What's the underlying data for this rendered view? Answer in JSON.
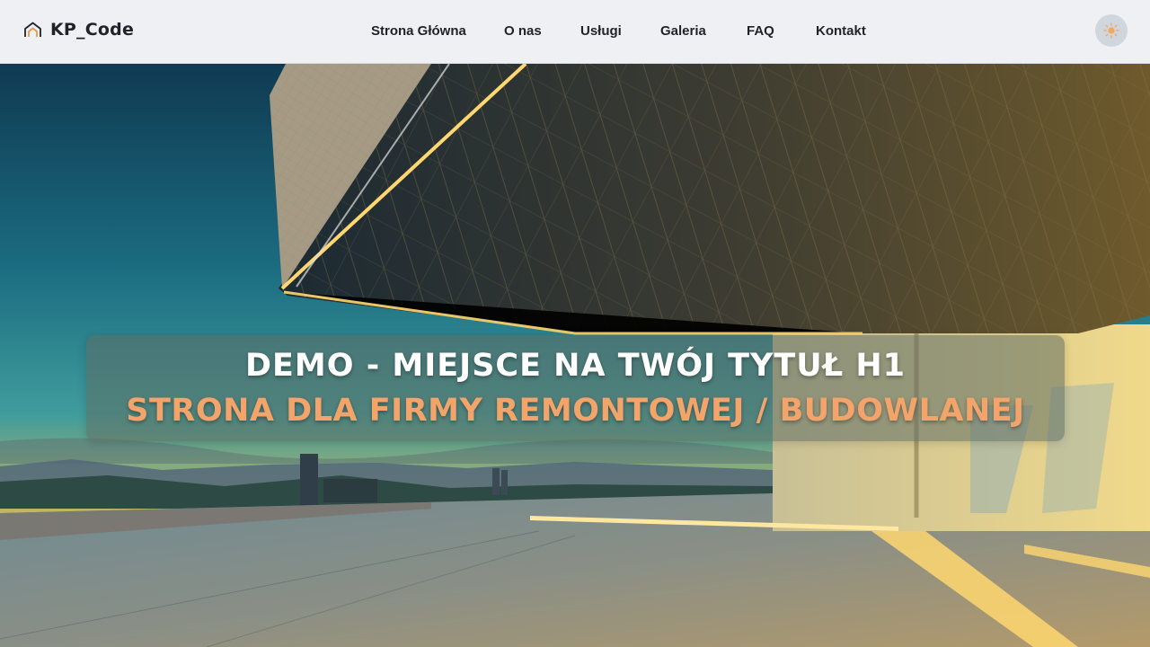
{
  "header": {
    "logo_text": "KP_Code",
    "logo_icon": "house-outline-icon",
    "nav": [
      {
        "label": "Strona Główna"
      },
      {
        "label": "O nas"
      },
      {
        "label": "Usługi"
      },
      {
        "label": "Galeria"
      },
      {
        "label": "FAQ"
      },
      {
        "label": "Kontakt"
      }
    ],
    "theme_toggle_icon": "sun-icon"
  },
  "hero": {
    "title": "DEMO - MIEJSCE NA TWÓJ TYTUŁ H1",
    "subtitle": "STRONA DLA FIRMY REMONTOWEJ / BUDOWLANEJ",
    "background_image": "modern-building-terrace-sunset-photo"
  },
  "colors": {
    "accent": "#f2a46a",
    "header_bg": "#eef0f4",
    "text_dark": "#1f2329"
  }
}
